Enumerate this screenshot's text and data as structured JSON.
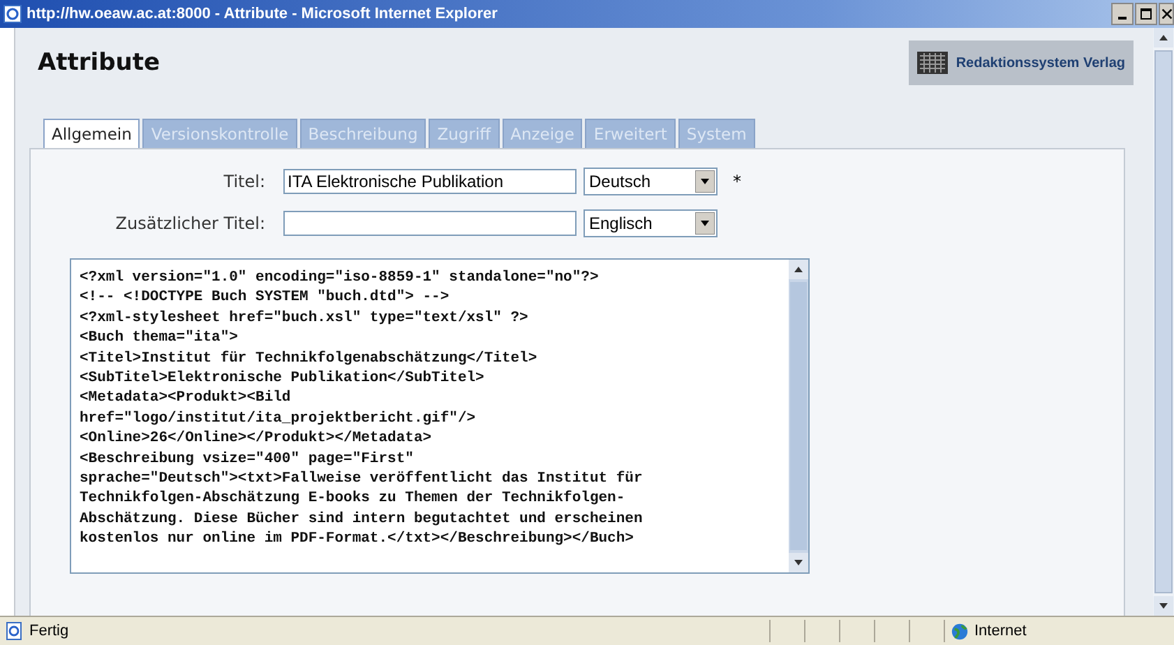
{
  "window": {
    "title": "http://hw.oeaw.ac.at:8000 - Attribute - Microsoft Internet Explorer"
  },
  "page": {
    "heading": "Attribute",
    "logo_text": "Redaktionssystem Verlag"
  },
  "tabs": [
    {
      "label": "Allgemein",
      "selected": true
    },
    {
      "label": "Versionskontrolle",
      "selected": false
    },
    {
      "label": "Beschreibung",
      "selected": false
    },
    {
      "label": "Zugriff",
      "selected": false
    },
    {
      "label": "Anzeige",
      "selected": false
    },
    {
      "label": "Erweitert",
      "selected": false
    },
    {
      "label": "System",
      "selected": false
    }
  ],
  "fields": [
    {
      "label": "Titel:",
      "value": "ITA Elektronische Publikation",
      "language": "Deutsch",
      "required_mark": "*"
    },
    {
      "label": "Zusätzlicher Titel:",
      "language": "Englisch"
    }
  ],
  "xml_source": [
    "<?xml version=\"1.0\" encoding=\"iso-8859-1\" standalone=\"no\"?>",
    "<!-- <!DOCTYPE Buch SYSTEM \"buch.dtd\"> -->",
    "<?xml-stylesheet href=\"buch.xsl\" type=\"text/xsl\" ?>",
    "<Buch thema=\"ita\">",
    "<Titel>Institut für Technikfolgenabschätzung</Titel>",
    "<SubTitel>Elektronische Publikation</SubTitel>",
    "<Metadata><Produkt><Bild",
    "href=\"logo/institut/ita_projektbericht.gif\"/>",
    "<Online>26</Online></Produkt></Metadata>",
    "<Beschreibung vsize=\"400\" page=\"First\"",
    "sprache=\"Deutsch\"><txt>Fallweise veröffentlicht das Institut für",
    "Technikfolgen-Abschätzung E-books zu Themen der Technikfolgen-",
    "Abschätzung. Diese Bücher sind intern begutachtet und erscheinen",
    "kostenlos nur online im PDF-Format.</txt></Beschreibung></Buch>"
  ],
  "status_bar": {
    "text": "Fertig",
    "zone": "Internet"
  }
}
